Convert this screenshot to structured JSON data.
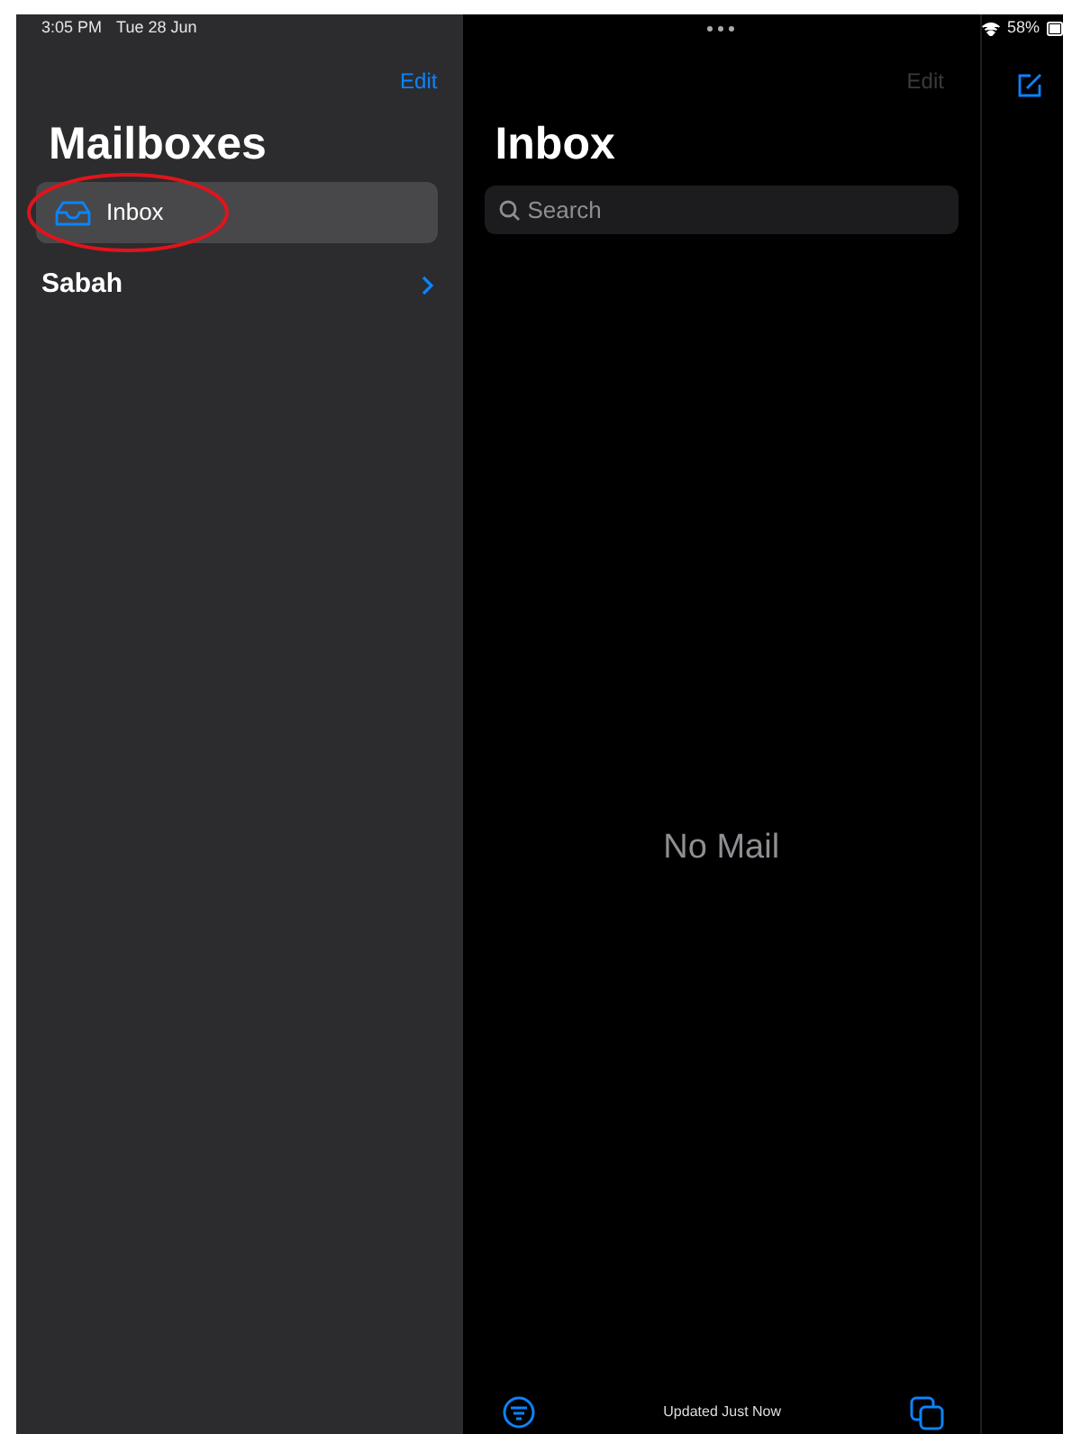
{
  "status_bar": {
    "time": "3:05 PM",
    "date": "Tue 28 Jun",
    "battery": "58%"
  },
  "sidebar": {
    "edit": "Edit",
    "title": "Mailboxes",
    "items": [
      {
        "kind": "mailbox",
        "label": "Inbox",
        "selected": true,
        "circled": true
      },
      {
        "kind": "account",
        "label": "Sabah",
        "selected": false,
        "circled": false
      }
    ]
  },
  "message_list": {
    "edit": {
      "label": "Edit",
      "disabled": true
    },
    "title": "Inbox",
    "search": {
      "placeholder": "Search"
    },
    "empty_text": "No Mail",
    "footer": "Updated Just Now"
  }
}
